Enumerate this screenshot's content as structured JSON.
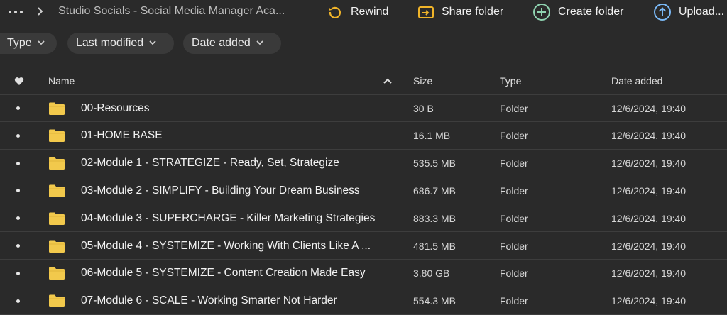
{
  "topbar": {
    "breadcrumb": "Studio Socials - Social Media Manager Aca...",
    "actions": [
      {
        "label": "Rewind",
        "icon": "rewind-icon"
      },
      {
        "label": "Share folder",
        "icon": "share-folder-icon"
      },
      {
        "label": "Create folder",
        "icon": "create-folder-icon"
      },
      {
        "label": "Upload...",
        "icon": "upload-icon"
      }
    ]
  },
  "filters": [
    {
      "label": "Type"
    },
    {
      "label": "Last modified"
    },
    {
      "label": "Date added"
    }
  ],
  "table": {
    "headers": {
      "name": "Name",
      "size": "Size",
      "type": "Type",
      "date_added": "Date added"
    },
    "rows": [
      {
        "name": "00-Resources",
        "size": "30 B",
        "type": "Folder",
        "date_added": "12/6/2024, 19:40"
      },
      {
        "name": "01-HOME BASE",
        "size": "16.1 MB",
        "type": "Folder",
        "date_added": "12/6/2024, 19:40"
      },
      {
        "name": "02-Module 1 - STRATEGIZE - Ready, Set, Strategize",
        "size": "535.5 MB",
        "type": "Folder",
        "date_added": "12/6/2024, 19:40"
      },
      {
        "name": "03-Module 2 - SIMPLIFY - Building Your Dream Business",
        "size": "686.7 MB",
        "type": "Folder",
        "date_added": "12/6/2024, 19:40"
      },
      {
        "name": "04-Module 3 - SUPERCHARGE - Killer Marketing Strategies",
        "size": "883.3 MB",
        "type": "Folder",
        "date_added": "12/6/2024, 19:40"
      },
      {
        "name": "05-Module 4 - SYSTEMIZE - Working With Clients Like A ...",
        "size": "481.5 MB",
        "type": "Folder",
        "date_added": "12/6/2024, 19:40"
      },
      {
        "name": "06-Module 5 - SYSTEMIZE - Content Creation Made Easy",
        "size": "3.80 GB",
        "type": "Folder",
        "date_added": "12/6/2024, 19:40"
      },
      {
        "name": "07-Module 6 - SCALE - Working Smarter Not Harder",
        "size": "554.3 MB",
        "type": "Folder",
        "date_added": "12/6/2024, 19:40"
      }
    ]
  },
  "colors": {
    "background": "#2a2a2a",
    "folder": "#f2c94c",
    "rewind_icon": "#f0b429",
    "share_icon": "#f0b429",
    "create_icon": "#8fd3b0",
    "upload_icon": "#7ab8f5"
  }
}
